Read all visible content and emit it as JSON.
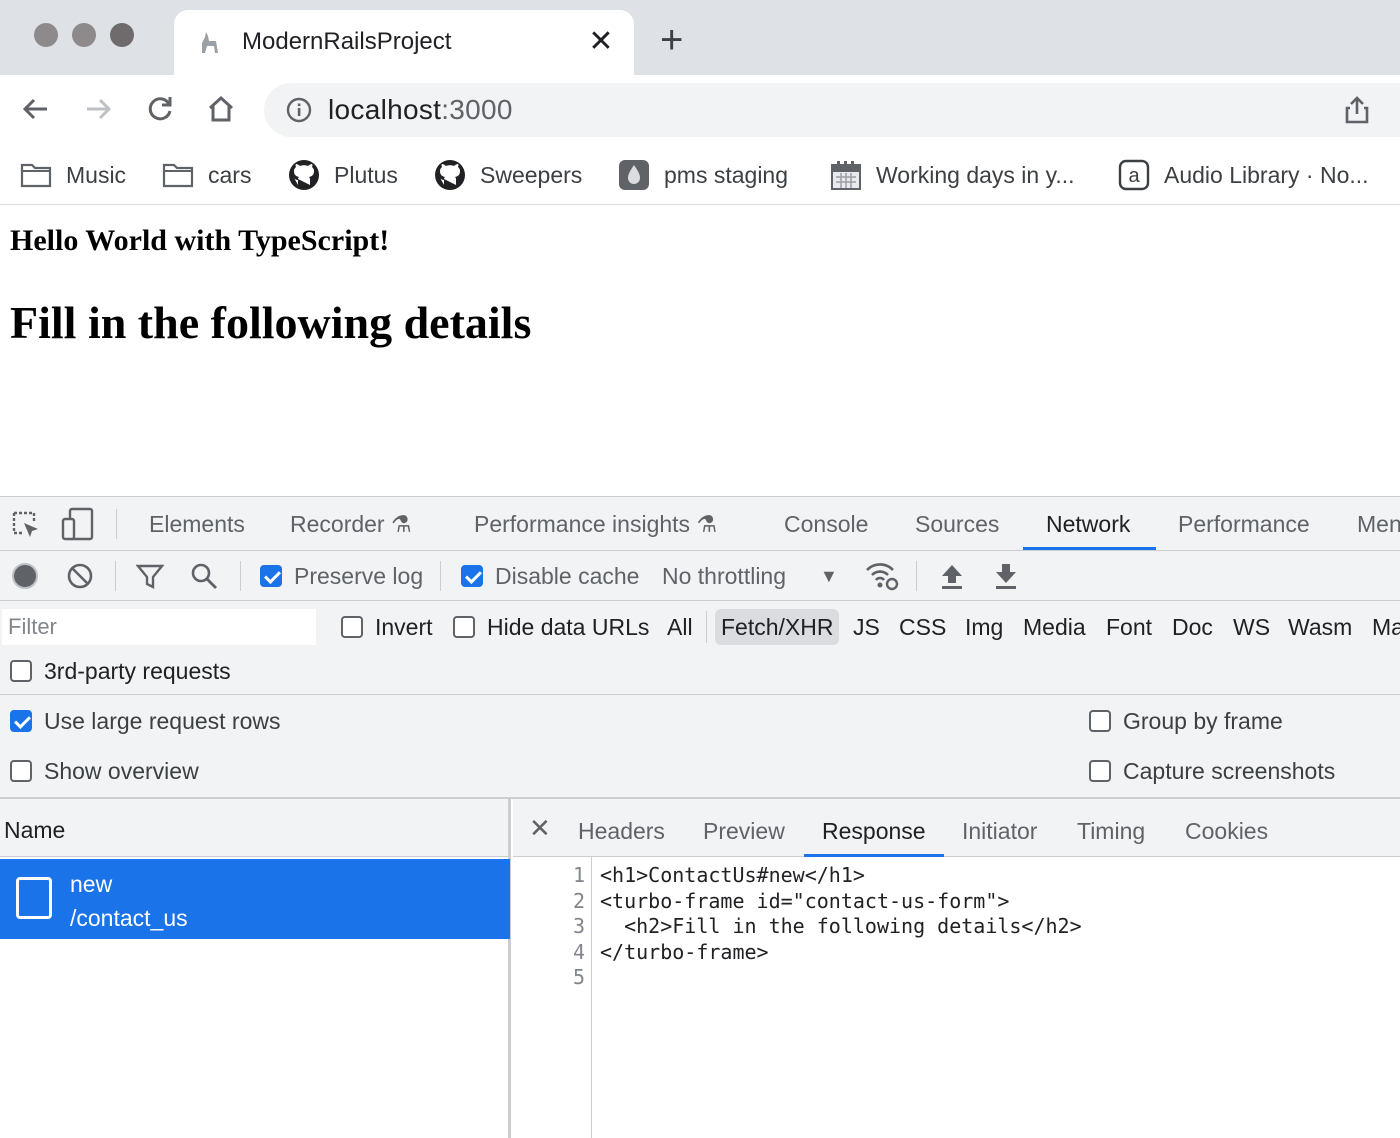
{
  "browser": {
    "tab_title": "ModernRailsProject",
    "url_host": "localhost",
    "url_port": ":3000",
    "bookmarks": [
      {
        "label": "Music",
        "icon": "folder-icon"
      },
      {
        "label": "cars",
        "icon": "folder-icon"
      },
      {
        "label": "Plutus",
        "icon": "github-icon"
      },
      {
        "label": "Sweepers",
        "icon": "github-icon"
      },
      {
        "label": "pms staging",
        "icon": "droplet-icon"
      },
      {
        "label": "Working days in y...",
        "icon": "calendar-icon"
      },
      {
        "label": "Audio Library · No...",
        "icon": "a-icon"
      }
    ]
  },
  "page": {
    "heading_small": "Hello World with TypeScript!",
    "heading_big": "Fill in the following details"
  },
  "devtools": {
    "tabs": [
      "Elements",
      "Recorder",
      "Performance insights",
      "Console",
      "Sources",
      "Network",
      "Performance",
      "Men"
    ],
    "active_tab": "Network",
    "toolbar": {
      "preserve_log": "Preserve log",
      "disable_cache": "Disable cache",
      "throttling": "No throttling"
    },
    "filter": {
      "placeholder": "Filter",
      "invert": "Invert",
      "hide_data_urls": "Hide data URLs",
      "types": [
        "All",
        "Fetch/XHR",
        "JS",
        "CSS",
        "Img",
        "Media",
        "Font",
        "Doc",
        "WS",
        "Wasm",
        "Ma"
      ],
      "active_type": "Fetch/XHR",
      "third_party": "3rd-party requests"
    },
    "settings": {
      "large_rows": "Use large request rows",
      "show_overview": "Show overview",
      "group_by_frame": "Group by frame",
      "capture_screenshots": "Capture screenshots"
    },
    "requests": {
      "column_name": "Name",
      "rows": [
        {
          "name": "new",
          "path": "/contact_us"
        }
      ]
    },
    "detail": {
      "tabs": [
        "Headers",
        "Preview",
        "Response",
        "Initiator",
        "Timing",
        "Cookies"
      ],
      "active_tab": "Response",
      "lines": [
        {
          "n": "1",
          "text": "<h1>ContactUs#new</h1>"
        },
        {
          "n": "2",
          "text": "<turbo-frame id=\"contact-us-form\">"
        },
        {
          "n": "3",
          "text": "  <h2>Fill in the following details</h2>"
        },
        {
          "n": "4",
          "text": "</turbo-frame>"
        },
        {
          "n": "5",
          "text": ""
        }
      ]
    }
  },
  "colors": {
    "accent": "#1a73e8",
    "devtools_bg": "#f1f3f4",
    "tabstrip_bg": "#dee1e6"
  }
}
